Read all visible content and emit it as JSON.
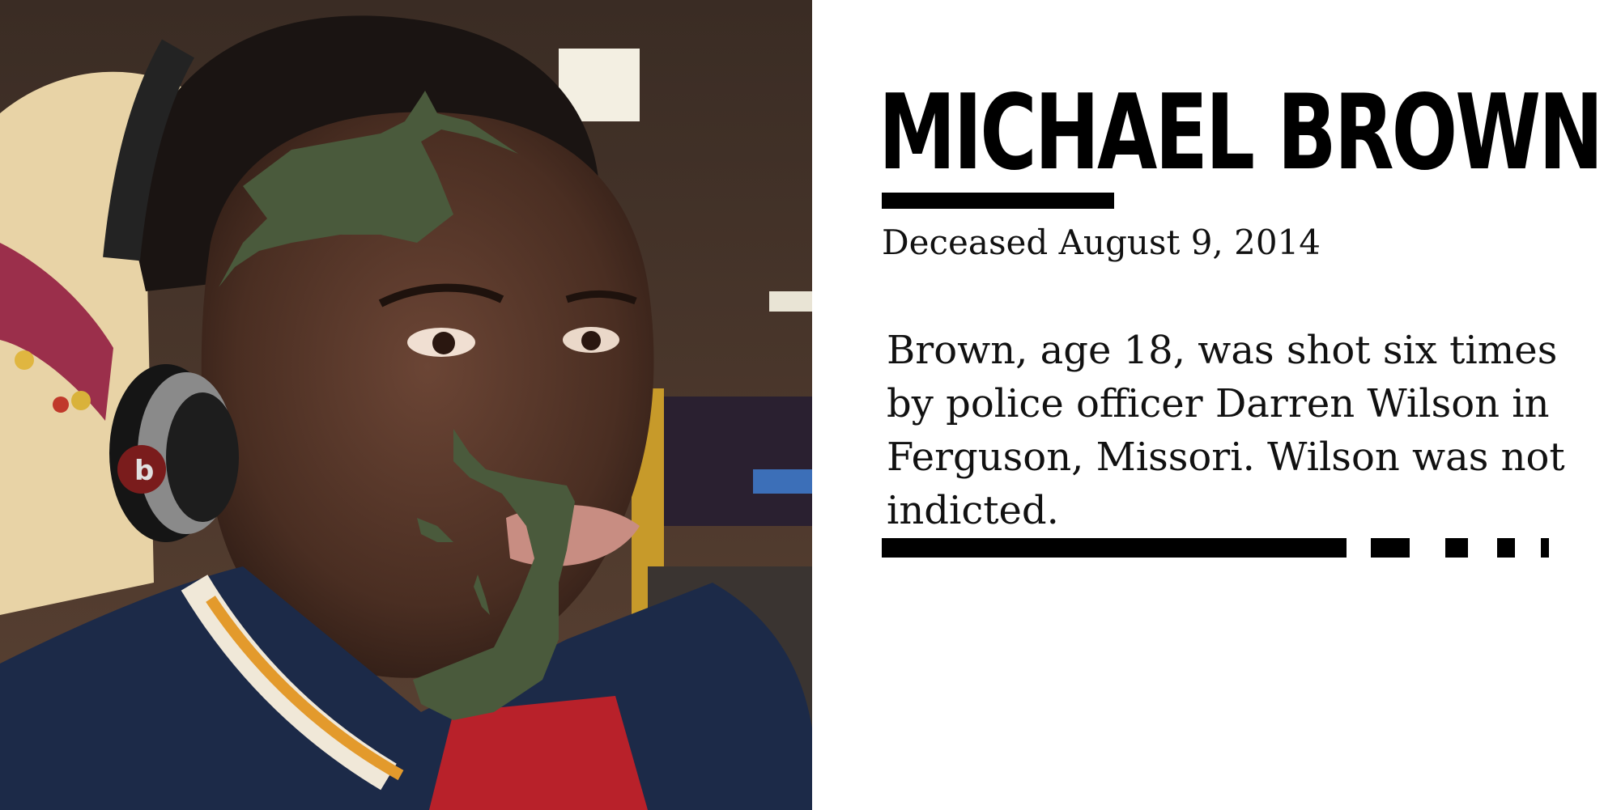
{
  "photo": {
    "alt": "",
    "headphone_brand_mark": "b"
  },
  "headline": {
    "name": "MICHAEL BROWN",
    "deceased": "Deceased August 9, 2014"
  },
  "bio": {
    "text": "Brown, age 18, was shot six times by police officer Darren Wilson in Ferguson, Missori. Wilson was not indicted."
  },
  "colors": {
    "text": "#000000",
    "overlay_green": "#4a5a3c",
    "background": "#ffffff"
  }
}
